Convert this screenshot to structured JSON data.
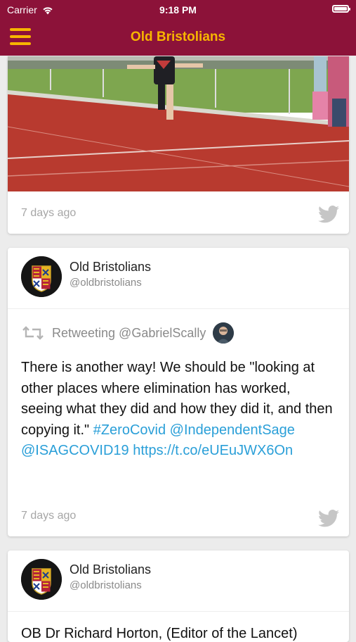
{
  "status_bar": {
    "carrier": "Carrier",
    "time": "9:18 PM"
  },
  "nav": {
    "title": "Old Bristolians",
    "menu_icon": "hamburger-menu-icon"
  },
  "colors": {
    "brand_maroon": "#8c1239",
    "accent_gold": "#f7b500",
    "link_blue": "#2a9fd8"
  },
  "feed": {
    "card1": {
      "timestamp": "7 days ago",
      "icon": "twitter-bird-icon"
    },
    "card2": {
      "name": "Old Bristolians",
      "handle": "@oldbristolians",
      "retweet_label": "Retweeting @GabrielScally",
      "text_before": "There is another way! We should be \"looking at other places where elimination has worked, seeing what they did and how they did it, and then copying it.\" ",
      "hashtag": "#ZeroCovid",
      "mention1": "@IndependentSage",
      "mention2": "@ISAGCOVID19",
      "url": "https://t.co/eUEuJWX6On",
      "timestamp": "7 days ago",
      "icon": "twitter-bird-icon"
    },
    "card3": {
      "name": "Old Bristolians",
      "handle": "@oldbristolians",
      "text_partial": "OB Dr Richard Horton, (Editor of the Lancet)"
    }
  }
}
